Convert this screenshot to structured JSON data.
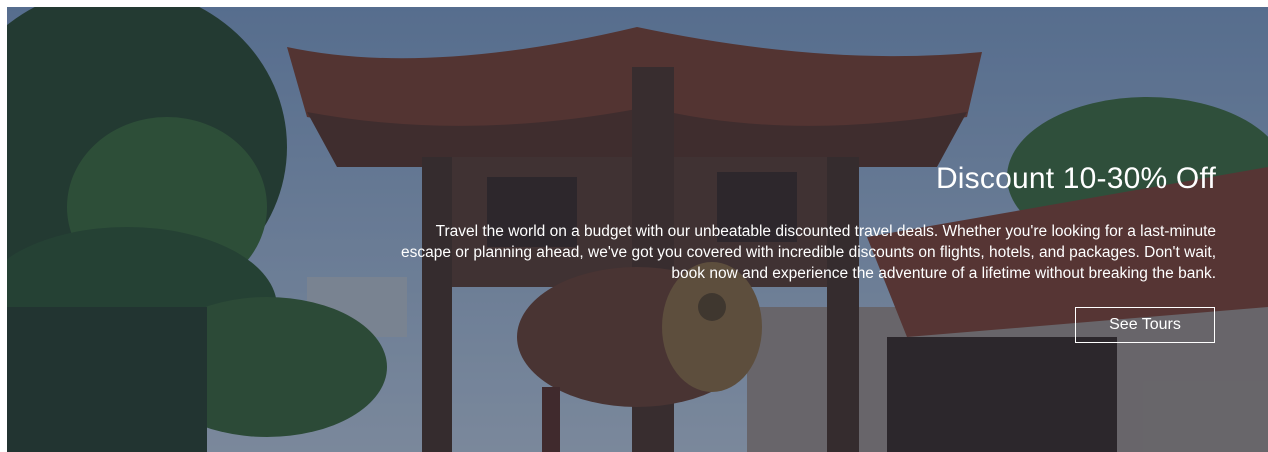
{
  "hero": {
    "title": "Discount 10-30% Off",
    "description": "Travel the world on a budget with our unbeatable discounted travel deals. Whether you're looking for a last-minute escape or planning ahead, we've got you covered with incredible discounts on flights, hotels, and packages. Don't wait, book now and experience the adventure of a lifetime without breaking the bank.",
    "cta_label": "See Tours"
  },
  "colors": {
    "overlay": "#14223c",
    "sky": "#6f8fb3",
    "roof": "#8a4a35",
    "wood": "#4a3226",
    "foliage": "#2f4a2e",
    "text": "#ffffff"
  }
}
